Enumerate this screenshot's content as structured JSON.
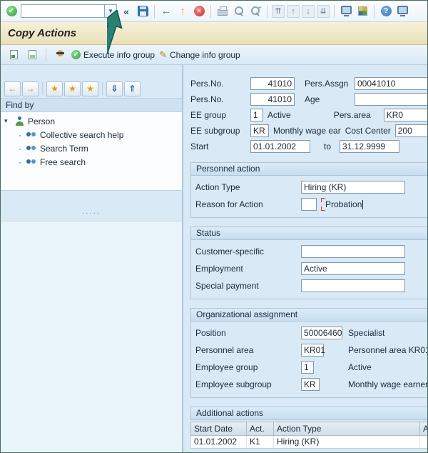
{
  "icons": {
    "enter_check": "✔",
    "dropdown_arrow": "▼",
    "collapse": "«",
    "back_arrow": "←",
    "exit_arrow": "↑",
    "cancel_x": "✕",
    "find_plus": "+",
    "page_first": "⇈",
    "page_up": "↑",
    "page_down": "↓",
    "page_last": "⇊",
    "help": "?",
    "execute_check": "✔",
    "change_pencil": "✎",
    "nav_left": "←",
    "nav_right": "→",
    "star": "★",
    "sort_down": "⇓",
    "sort_up": "⇑",
    "expander": "▾",
    "bullet": "·",
    "splitter_dots": "·····"
  },
  "header": {
    "title": "Copy Actions"
  },
  "toolbar": {
    "command_value": ""
  },
  "app_toolbar": {
    "execute_label": "Execute info group",
    "change_label": "Change info group"
  },
  "sidebar": {
    "find_by": "Find by",
    "tree_root": "Person",
    "tree_items": [
      "Collective search help",
      "Search Term",
      "Free search"
    ]
  },
  "form": {
    "rows": [
      {
        "label": "Pers.No.",
        "value": "41010",
        "label2": "Pers.Assgn",
        "value2": "00041010"
      },
      {
        "label": "Pers.No.",
        "value": "41010",
        "label2": "Age",
        "value2": ""
      },
      {
        "label": "EE group",
        "value": "1",
        "desc": "Active",
        "label2": "Pers.area",
        "value2": "KR0"
      },
      {
        "label": "EE subgroup",
        "value": "KR",
        "desc": "Monthly wage ear",
        "label2": "Cost Center",
        "value2": "200"
      },
      {
        "label": "Start",
        "value": "01.01.2002",
        "label2": "to",
        "value2": "31.12.9999"
      }
    ]
  },
  "personnel_action": {
    "title": "Personnel action",
    "action_type_label": "Action Type",
    "action_type_value": "Hiring (KR)",
    "reason_label": "Reason for Action",
    "reason_value": "",
    "reason_text": "Probation"
  },
  "status": {
    "title": "Status",
    "rows": [
      {
        "label": "Customer-specific",
        "value": ""
      },
      {
        "label": "Employment",
        "value": "Active"
      },
      {
        "label": "Special payment",
        "value": ""
      }
    ]
  },
  "org": {
    "title": "Organizational assignment",
    "rows": [
      {
        "label": "Position",
        "value": "50006460",
        "desc": "Specialist"
      },
      {
        "label": "Personnel area",
        "value": "KR01",
        "desc": "Personnel area KR01"
      },
      {
        "label": "Employee group",
        "value": "1",
        "desc": "Active"
      },
      {
        "label": "Employee subgroup",
        "value": "KR",
        "desc": "Monthly wage earner"
      }
    ]
  },
  "additional_actions": {
    "title": "Additional actions",
    "columns": [
      "Start Date",
      "Act.",
      "Action Type",
      "A"
    ],
    "rows": [
      {
        "start": "01.01.2002",
        "act": "K1",
        "type": "Hiring (KR)",
        "last": ""
      }
    ]
  }
}
